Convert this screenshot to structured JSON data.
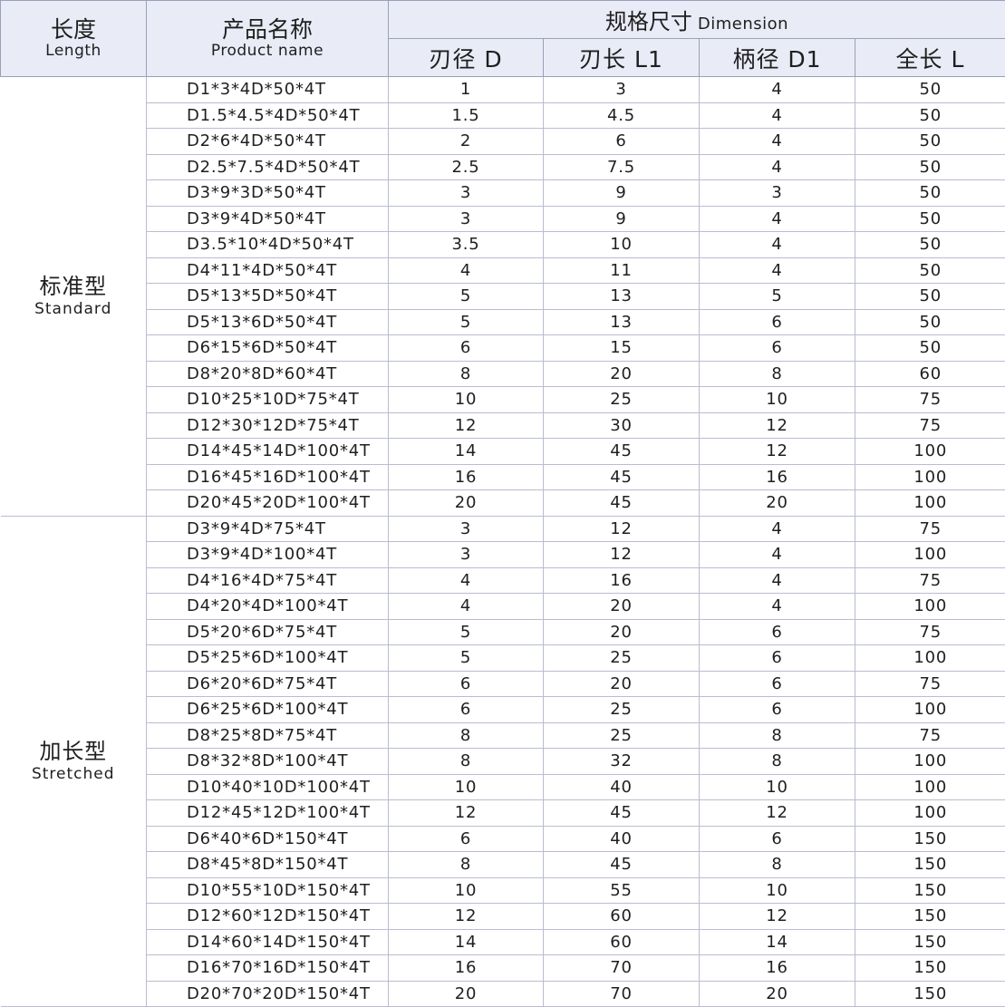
{
  "header": {
    "length_cn": "长度",
    "length_en": "Length",
    "name_cn": "产品名称",
    "name_en": "Product name",
    "dimension_cn": "规格尺寸",
    "dimension_en": "Dimension",
    "sub": [
      "刃径 D",
      "刃长 L1",
      "柄径 D1",
      "全长 L"
    ]
  },
  "groups": [
    {
      "cn": "标准型",
      "en": "Standard",
      "rows": [
        [
          "D1*3*4D*50*4T",
          "1",
          "3",
          "4",
          "50"
        ],
        [
          "D1.5*4.5*4D*50*4T",
          "1.5",
          "4.5",
          "4",
          "50"
        ],
        [
          "D2*6*4D*50*4T",
          "2",
          "6",
          "4",
          "50"
        ],
        [
          "D2.5*7.5*4D*50*4T",
          "2.5",
          "7.5",
          "4",
          "50"
        ],
        [
          "D3*9*3D*50*4T",
          "3",
          "9",
          "3",
          "50"
        ],
        [
          "D3*9*4D*50*4T",
          "3",
          "9",
          "4",
          "50"
        ],
        [
          "D3.5*10*4D*50*4T",
          "3.5",
          "10",
          "4",
          "50"
        ],
        [
          "D4*11*4D*50*4T",
          "4",
          "11",
          "4",
          "50"
        ],
        [
          "D5*13*5D*50*4T",
          "5",
          "13",
          "5",
          "50"
        ],
        [
          "D5*13*6D*50*4T",
          "5",
          "13",
          "6",
          "50"
        ],
        [
          "D6*15*6D*50*4T",
          "6",
          "15",
          "6",
          "50"
        ],
        [
          "D8*20*8D*60*4T",
          "8",
          "20",
          "8",
          "60"
        ],
        [
          "D10*25*10D*75*4T",
          "10",
          "25",
          "10",
          "75"
        ],
        [
          "D12*30*12D*75*4T",
          "12",
          "30",
          "12",
          "75"
        ],
        [
          "D14*45*14D*100*4T",
          "14",
          "45",
          "12",
          "100"
        ],
        [
          "D16*45*16D*100*4T",
          "16",
          "45",
          "16",
          "100"
        ],
        [
          "D20*45*20D*100*4T",
          "20",
          "45",
          "20",
          "100"
        ]
      ]
    },
    {
      "cn": "加长型",
      "en": "Stretched",
      "rows": [
        [
          "D3*9*4D*75*4T",
          "3",
          "12",
          "4",
          "75"
        ],
        [
          "D3*9*4D*100*4T",
          "3",
          "12",
          "4",
          "100"
        ],
        [
          "D4*16*4D*75*4T",
          "4",
          "16",
          "4",
          "75"
        ],
        [
          "D4*20*4D*100*4T",
          "4",
          "20",
          "4",
          "100"
        ],
        [
          "D5*20*6D*75*4T",
          "5",
          "20",
          "6",
          "75"
        ],
        [
          "D5*25*6D*100*4T",
          "5",
          "25",
          "6",
          "100"
        ],
        [
          "D6*20*6D*75*4T",
          "6",
          "20",
          "6",
          "75"
        ],
        [
          "D6*25*6D*100*4T",
          "6",
          "25",
          "6",
          "100"
        ],
        [
          "D8*25*8D*75*4T",
          "8",
          "25",
          "8",
          "75"
        ],
        [
          "D8*32*8D*100*4T",
          "8",
          "32",
          "8",
          "100"
        ],
        [
          "D10*40*10D*100*4T",
          "10",
          "40",
          "10",
          "100"
        ],
        [
          "D12*45*12D*100*4T",
          "12",
          "45",
          "12",
          "100"
        ],
        [
          "D6*40*6D*150*4T",
          "6",
          "40",
          "6",
          "150"
        ],
        [
          "D8*45*8D*150*4T",
          "8",
          "45",
          "8",
          "150"
        ],
        [
          "D10*55*10D*150*4T",
          "10",
          "55",
          "10",
          "150"
        ],
        [
          "D12*60*12D*150*4T",
          "12",
          "60",
          "12",
          "150"
        ],
        [
          "D14*60*14D*150*4T",
          "14",
          "60",
          "14",
          "150"
        ],
        [
          "D16*70*16D*150*4T",
          "16",
          "70",
          "16",
          "150"
        ],
        [
          "D20*70*20D*150*4T",
          "20",
          "70",
          "20",
          "150"
        ]
      ]
    }
  ]
}
